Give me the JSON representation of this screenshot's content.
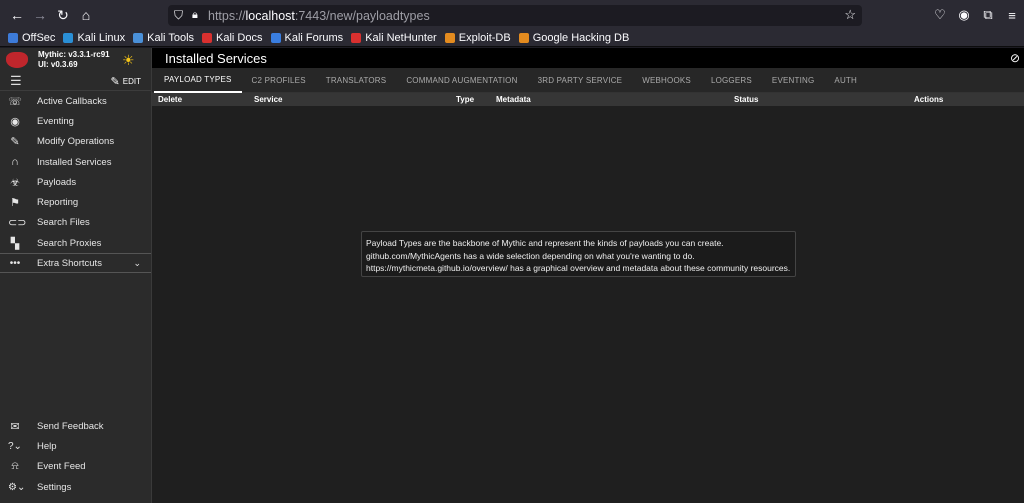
{
  "browser": {
    "url_prefix": "https://",
    "url_host": "localhost",
    "url_rest": ":7443/new/payloadtypes"
  },
  "bookmarks": [
    {
      "label": "OffSec",
      "color": "#3d7bd9"
    },
    {
      "label": "Kali Linux",
      "color": "#2a8fd6"
    },
    {
      "label": "Kali Tools",
      "color": "#4a90d9"
    },
    {
      "label": "Kali Docs",
      "color": "#d9302f"
    },
    {
      "label": "Kali Forums",
      "color": "#3a7ee0"
    },
    {
      "label": "Kali NetHunter",
      "color": "#d9302f"
    },
    {
      "label": "Exploit-DB",
      "color": "#e38b1f"
    },
    {
      "label": "Google Hacking DB",
      "color": "#e38b1f"
    }
  ],
  "sidebar": {
    "version_mythic": "Mythic: v3.3.1-rc91",
    "version_ui": "UI: v0.3.69",
    "edit_label": "EDIT",
    "items": [
      {
        "label": "Active Callbacks",
        "icon": "phone-callback-icon",
        "glyph": "☏"
      },
      {
        "label": "Eventing",
        "icon": "play-circle-icon",
        "glyph": "◉"
      },
      {
        "label": "Modify Operations",
        "icon": "pencil-icon",
        "glyph": "✎"
      },
      {
        "label": "Installed Services",
        "icon": "headphones-icon",
        "glyph": "∩"
      },
      {
        "label": "Payloads",
        "icon": "biohazard-icon",
        "glyph": "☣"
      },
      {
        "label": "Reporting",
        "icon": "flag-icon",
        "glyph": "⚑"
      },
      {
        "label": "Search Files",
        "icon": "link-icon",
        "glyph": "⊂⊃"
      },
      {
        "label": "Search Proxies",
        "icon": "socks-icon",
        "glyph": "▚"
      }
    ],
    "extra_label": "Extra Shortcuts",
    "bottom_items": [
      {
        "label": "Send Feedback",
        "icon": "feedback-icon",
        "glyph": "✉"
      },
      {
        "label": "Help",
        "icon": "help-icon",
        "glyph": "?⌄"
      },
      {
        "label": "Event Feed",
        "icon": "bell-icon",
        "glyph": "⍾"
      },
      {
        "label": "Settings",
        "icon": "settings-icon",
        "glyph": "⚙⌄"
      }
    ]
  },
  "main": {
    "title": "Installed Services",
    "tabs": [
      {
        "label": "PAYLOAD TYPES",
        "active": true
      },
      {
        "label": "C2 PROFILES"
      },
      {
        "label": "TRANSLATORS"
      },
      {
        "label": "COMMAND AUGMENTATION"
      },
      {
        "label": "3RD PARTY SERVICE"
      },
      {
        "label": "WEBHOOKS"
      },
      {
        "label": "LOGGERS"
      },
      {
        "label": "EVENTING"
      },
      {
        "label": "AUTH"
      }
    ],
    "columns": {
      "delete": "Delete",
      "service": "Service",
      "type": "Type",
      "metadata": "Metadata",
      "status": "Status",
      "actions": "Actions"
    },
    "info": {
      "line1": "Payload Types are the backbone of Mythic and represent the kinds of payloads you can create.",
      "line2": "github.com/MythicAgents has a wide selection depending on what you're wanting to do.",
      "line3": "https://mythicmeta.github.io/overview/ has a graphical overview and metadata about these community resources."
    }
  }
}
